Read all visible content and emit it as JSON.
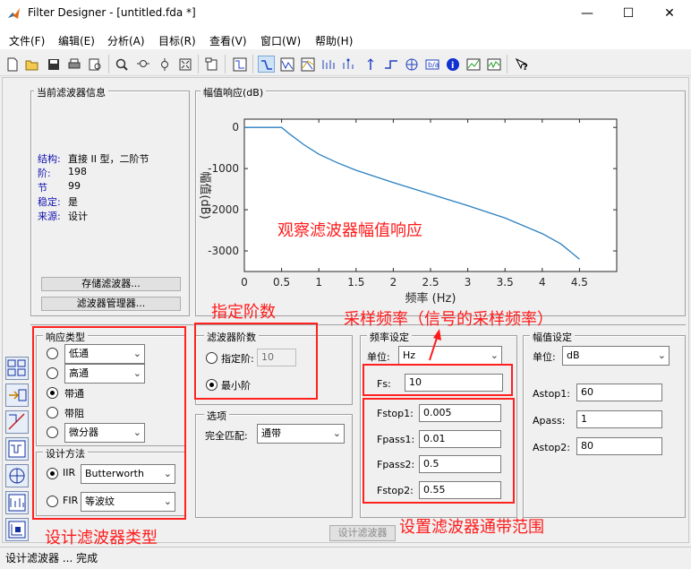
{
  "window": {
    "title": "Filter Designer -  [untitled.fda *]",
    "minimize": "—",
    "maximize": "☐",
    "close": "✕"
  },
  "menu": [
    "文件(F)",
    "编辑(E)",
    "分析(A)",
    "目标(R)",
    "查看(V)",
    "窗口(W)",
    "帮助(H)"
  ],
  "toolbar_icons": [
    "new-icon",
    "open-icon",
    "save-icon",
    "print-icon",
    "print-preview-icon",
    "zoom-in-icon",
    "zoom-x-icon",
    "zoom-y-icon",
    "full-view-icon",
    "new-figure-icon",
    "filter-specs-icon",
    "magnitude-response-icon",
    "phase-response-icon",
    "mag-phase-icon",
    "group-delay-icon",
    "phase-delay-icon",
    "impulse-response-icon",
    "step-response-icon",
    "pole-zero-icon",
    "coefficients-icon",
    "info-icon",
    "cost-icon",
    "noise-icon",
    "help-icon"
  ],
  "current_filter": {
    "title": "当前滤波器信息",
    "rows": [
      {
        "key": "结构:",
        "value": "直接 II 型，二阶节"
      },
      {
        "key": "阶:",
        "value": "198"
      },
      {
        "key": "节",
        "value": "99"
      },
      {
        "key": "稳定:",
        "value": "是"
      },
      {
        "key": "来源:",
        "value": "设计"
      }
    ],
    "store_button": "存储滤波器...",
    "manager_button": "滤波器管理器..."
  },
  "plot": {
    "title": "幅值响应(dB)",
    "chart_data": {
      "type": "line",
      "xlabel": "频率 (Hz)",
      "ylabel": "幅值(dB)",
      "xlim": [
        0,
        5
      ],
      "ylim": [
        -3500,
        200
      ],
      "xticks": [
        "0",
        "0.5",
        "1",
        "1.5",
        "2",
        "2.5",
        "3",
        "3.5",
        "4",
        "4.5"
      ],
      "yticks": [
        "0",
        "-1000",
        "-2000",
        "-3000"
      ],
      "x": [
        0,
        0.5,
        0.6,
        0.8,
        1.0,
        1.25,
        1.5,
        2.0,
        2.5,
        3.0,
        3.5,
        4.0,
        4.25,
        4.5
      ],
      "y": [
        0,
        0,
        -150,
        -420,
        -650,
        -860,
        -1040,
        -1340,
        -1620,
        -1900,
        -2200,
        -2580,
        -2830,
        -3200
      ],
      "line_color": "#2a7fc0"
    },
    "annotation": "观察滤波器幅值响应"
  },
  "annotations": {
    "order": "指定阶数",
    "fs": "采样频率（信号的采样频率）",
    "type": "设计滤波器类型",
    "passband": "设置滤波器通带范围"
  },
  "response_type": {
    "title": "响应类型",
    "options": [
      {
        "label": "低通",
        "select": true,
        "selected": false
      },
      {
        "label": "高通",
        "select": true,
        "selected": false
      },
      {
        "label": "带通",
        "select": false,
        "selected": true
      },
      {
        "label": "带阻",
        "select": false,
        "selected": false
      },
      {
        "label": "微分器",
        "select": true,
        "selected": false
      }
    ]
  },
  "design_method": {
    "title": "设计方法",
    "iir_label": "IIR",
    "iir_value": "Butterworth",
    "fir_label": "FIR",
    "fir_value": "等波纹",
    "selected": "IIR"
  },
  "filter_order": {
    "title": "滤波器阶数",
    "specify_label": "指定阶:",
    "specify_value": "10",
    "min_label": "最小阶",
    "selected": "min"
  },
  "options": {
    "title": "选项",
    "match_label": "完全匹配:",
    "match_value": "通带"
  },
  "freq_spec": {
    "title": "频率设定",
    "unit_label": "单位:",
    "unit_value": "Hz",
    "fs_label": "Fs:",
    "fs_value": "10",
    "fstop1_label": "Fstop1:",
    "fstop1_value": "0.005",
    "fpass1_label": "Fpass1:",
    "fpass1_value": "0.01",
    "fpass2_label": "Fpass2:",
    "fpass2_value": "0.5",
    "fstop2_label": "Fstop2:",
    "fstop2_value": "0.55"
  },
  "mag_spec": {
    "title": "幅值设定",
    "unit_label": "单位:",
    "unit_value": "dB",
    "astop1_label": "Astop1:",
    "astop1_value": "60",
    "apass_label": "Apass:",
    "apass_value": "1",
    "astop2_label": "Astop2:",
    "astop2_value": "80"
  },
  "design_button": "设计滤波器",
  "status": "设计滤波器 ... 完成"
}
